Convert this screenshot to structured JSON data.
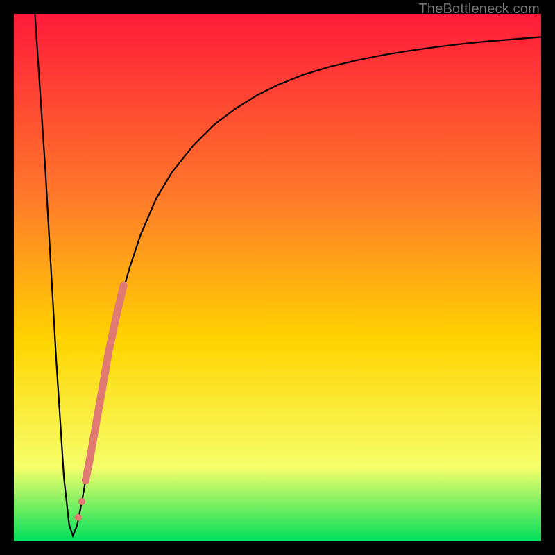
{
  "watermark": "TheBottleneck.com",
  "chart_data": {
    "type": "line",
    "title": "",
    "xlabel": "",
    "ylabel": "",
    "xlim": [
      0,
      100
    ],
    "ylim": [
      0,
      100
    ],
    "grid": false,
    "legend": false,
    "background_gradient": {
      "top_color": "#ff1a3a",
      "mid_colors": [
        "#ff7a2a",
        "#ffd400",
        "#f6ff6a"
      ],
      "bottom_color": "#00e05a"
    },
    "series": [
      {
        "name": "curve",
        "stroke": "#000000",
        "x": [
          4,
          6,
          8,
          9.5,
          10.5,
          11.2,
          12,
          13,
          14,
          15,
          16,
          18,
          20,
          22,
          24,
          27,
          30,
          34,
          38,
          42,
          46,
          50,
          55,
          60,
          65,
          70,
          75,
          80,
          85,
          90,
          95,
          100
        ],
        "y": [
          100,
          70,
          35,
          12,
          3,
          1,
          3,
          8,
          14,
          20,
          26,
          36,
          45,
          52,
          58,
          65,
          70,
          75,
          79,
          82,
          84.5,
          86.5,
          88.5,
          90,
          91.2,
          92.2,
          93,
          93.7,
          94.3,
          94.8,
          95.2,
          95.6
        ]
      }
    ],
    "highlight_segment": {
      "name": "highlighted-points",
      "stroke": "#e07a72",
      "points": [
        {
          "x": 13.6,
          "y": 11.5
        },
        {
          "x": 14.4,
          "y": 15.5
        },
        {
          "x": 15.2,
          "y": 20.0
        },
        {
          "x": 16.6,
          "y": 28.0
        },
        {
          "x": 18.0,
          "y": 36.0
        },
        {
          "x": 19.4,
          "y": 42.5
        },
        {
          "x": 20.8,
          "y": 48.5
        }
      ],
      "extra_dots": [
        {
          "x": 12.2,
          "y": 4.5
        },
        {
          "x": 12.9,
          "y": 7.5
        }
      ]
    }
  }
}
